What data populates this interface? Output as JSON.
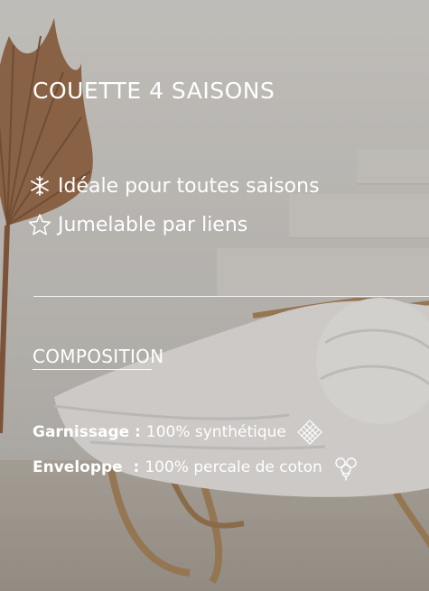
{
  "title": "COUETTE 4 SAISONS",
  "features": [
    {
      "icon": "snowflake-sun-icon",
      "label": "Idéale pour toutes saisons"
    },
    {
      "icon": "star-outline-icon",
      "label": "Jumelable par liens"
    }
  ],
  "composition": {
    "heading": "COMPOSITION",
    "rows": [
      {
        "label": "Garnissage :",
        "value": "100% synthétique",
        "icon": "fiber-weave-icon"
      },
      {
        "label": "Enveloppe  :",
        "value": "100% percale de coton",
        "icon": "cotton-flower-icon"
      }
    ]
  },
  "colors": {
    "text": "#ffffff",
    "divider": "#ffffff"
  }
}
